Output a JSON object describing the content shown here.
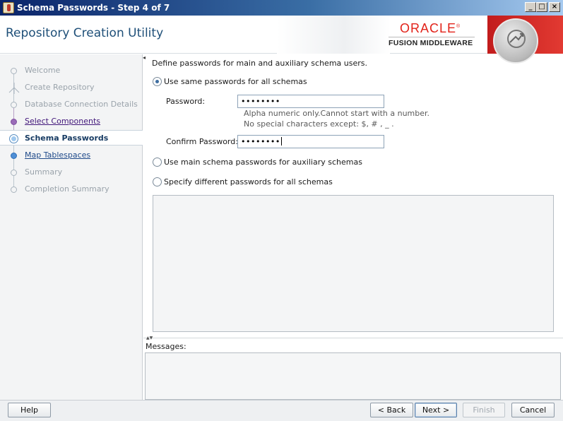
{
  "window": {
    "title": "Schema Passwords - Step 4 of 7",
    "minimize_glyph": "_",
    "maximize_glyph": "□",
    "close_glyph": "×"
  },
  "header": {
    "app_title": "Repository Creation Utility",
    "oracle_logo": "ORACLE",
    "logo_mark": "®",
    "product_line": "FUSION MIDDLEWARE",
    "brand_color": "#e2231a"
  },
  "sidebar": {
    "items": [
      {
        "label": "Welcome",
        "state": "disabled"
      },
      {
        "label": "Create Repository",
        "state": "disabled"
      },
      {
        "label": "Database Connection Details",
        "state": "disabled"
      },
      {
        "label": "Select Components",
        "state": "visited-link"
      },
      {
        "label": "Schema Passwords",
        "state": "current"
      },
      {
        "label": "Map Tablespaces",
        "state": "link"
      },
      {
        "label": "Summary",
        "state": "disabled"
      },
      {
        "label": "Completion Summary",
        "state": "disabled"
      }
    ]
  },
  "main": {
    "intro": "Define passwords for main and auxiliary schema users.",
    "option_same": "Use same passwords for all schemas",
    "option_main": "Use main schema passwords for auxiliary schemas",
    "option_different": "Specify different passwords for all schemas",
    "selected_option": "same",
    "password_label": "Password:",
    "password_value": "••••••••",
    "hint_line1": "Alpha numeric only.Cannot start with a number.",
    "hint_line2": "No special characters except: $, # , _ .",
    "confirm_label": "Confirm Password:",
    "confirm_value": "••••••••"
  },
  "messages": {
    "label": "Messages:"
  },
  "footer": {
    "help": "Help",
    "back": "< Back",
    "next": "Next >",
    "finish": "Finish",
    "cancel": "Cancel"
  }
}
